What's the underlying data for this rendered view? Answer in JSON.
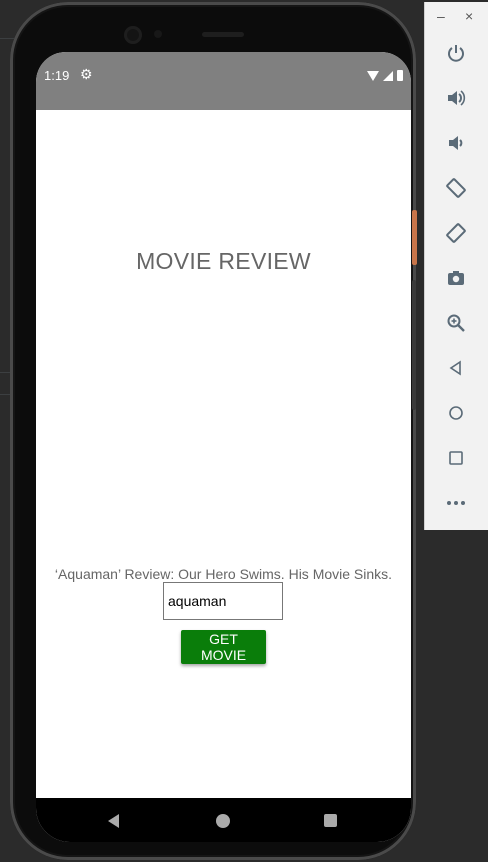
{
  "status_bar": {
    "time": "1:19",
    "settings_icon": "gear-icon"
  },
  "app": {
    "title": "MOVIE REVIEW",
    "review_headline": "‘Aquaman’ Review: Our Hero Swims. His Movie Sinks.",
    "search_input": {
      "value": "aquaman",
      "placeholder": ""
    },
    "button_label": "GET MOVIE"
  },
  "colors": {
    "accent_button": "#0a7d0a",
    "status_bar": "#808080",
    "text": "#666666"
  },
  "emulator_panel": {
    "window_controls": {
      "minimize": "–",
      "close": "×"
    },
    "tools": [
      "power-icon",
      "volume-up-icon",
      "volume-down-icon",
      "rotate-left-icon",
      "rotate-right-icon",
      "camera-icon",
      "zoom-icon",
      "back-icon",
      "home-icon",
      "overview-icon",
      "more-icon"
    ]
  }
}
